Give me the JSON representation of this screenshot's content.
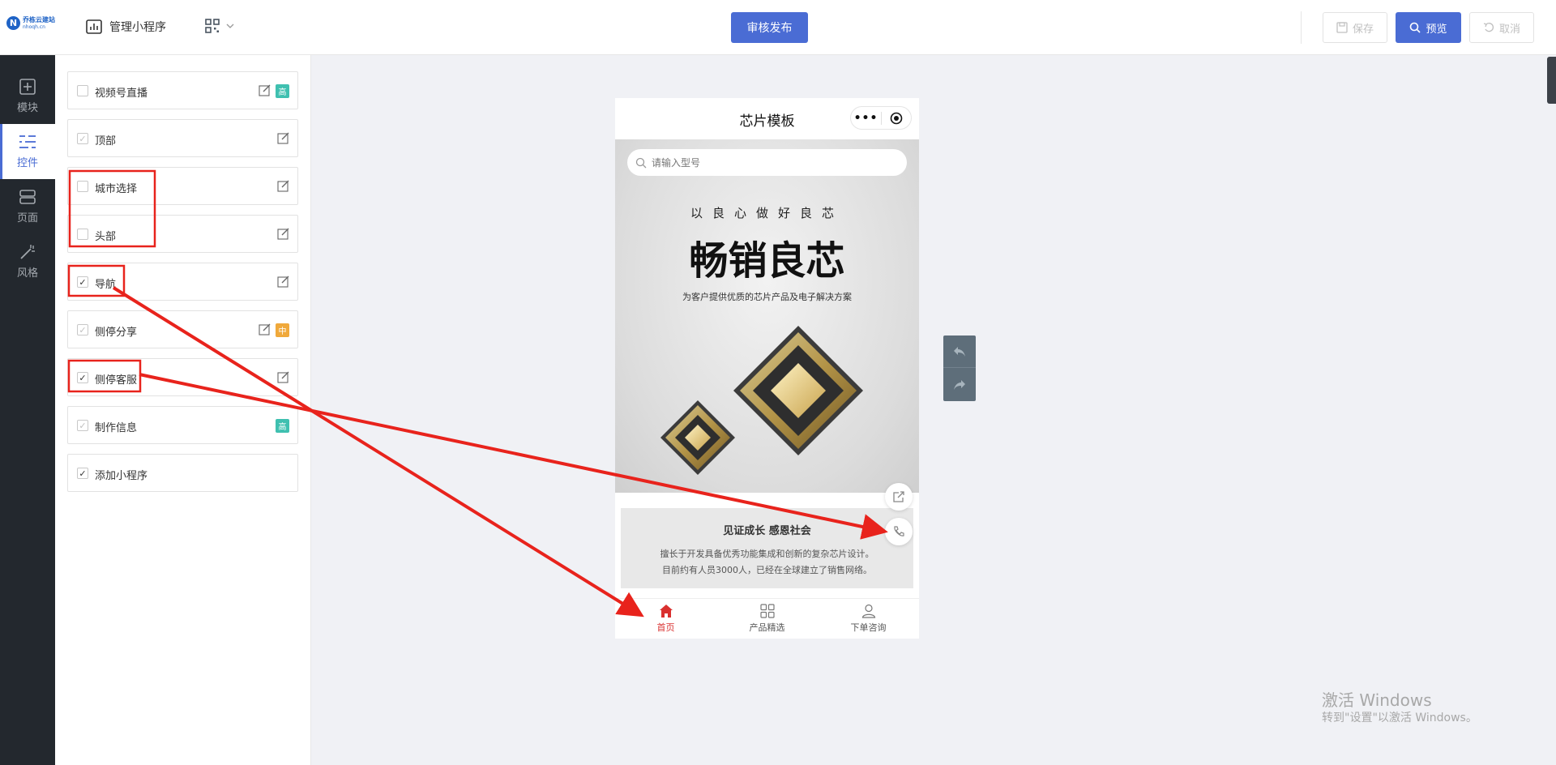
{
  "header": {
    "logo": {
      "name": "乔栋云建站",
      "domain": "nhoqh.cn"
    },
    "manage_label": "管理小程序",
    "publish_label": "审核发布",
    "save_label": "保存",
    "preview_label": "预览",
    "cancel_label": "取消"
  },
  "leftnav": [
    {
      "label": "模块",
      "icon": "plus-square-icon"
    },
    {
      "label": "控件",
      "icon": "controls-icon"
    },
    {
      "label": "页面",
      "icon": "pages-icon"
    },
    {
      "label": "风格",
      "icon": "magic-wand-icon"
    }
  ],
  "controls": [
    {
      "label": "视频号直播",
      "checked": false,
      "tag": "高",
      "tag_color": "#3fc0b0"
    },
    {
      "label": "顶部",
      "checked": true,
      "dim": true
    },
    {
      "label": "城市选择",
      "checked": false
    },
    {
      "label": "头部",
      "checked": false
    },
    {
      "label": "导航",
      "checked": true
    },
    {
      "label": "侧停分享",
      "checked": true,
      "dim": true,
      "tag": "中",
      "tag_color": "#f0a93b"
    },
    {
      "label": "侧停客服",
      "checked": true
    },
    {
      "label": "制作信息",
      "checked": true,
      "dim": true,
      "tag": "高",
      "tag_color": "#3fc0b0"
    },
    {
      "label": "添加小程序",
      "checked": true
    }
  ],
  "phone": {
    "title": "芯片模板",
    "capsule_dots": "•••",
    "search_placeholder": "请输入型号",
    "slogan_small": "以良心做好良芯",
    "slogan_big": "畅销良芯",
    "slogan_sub": "为客户提供优质的芯片产品及电子解决方案",
    "info_title": "见证成长  感恩社会",
    "info_line1": "擅长于开发具备优秀功能集成和创新的复杂芯片设计。",
    "info_line2": "目前约有人员3000人，已经在全球建立了销售网络。",
    "tabs": [
      {
        "label": "首页",
        "icon": "home-icon",
        "active": true
      },
      {
        "label": "产品精选",
        "icon": "grid-icon",
        "active": false
      },
      {
        "label": "下单咨询",
        "icon": "user-icon",
        "active": false
      }
    ]
  },
  "watermark": {
    "line1": "激活 Windows",
    "line2": "转到\"设置\"以激活 Windows。"
  },
  "colors": {
    "accent": "#4a6cd4",
    "annotation": "#e8231c",
    "active_tab": "#d9302f"
  }
}
